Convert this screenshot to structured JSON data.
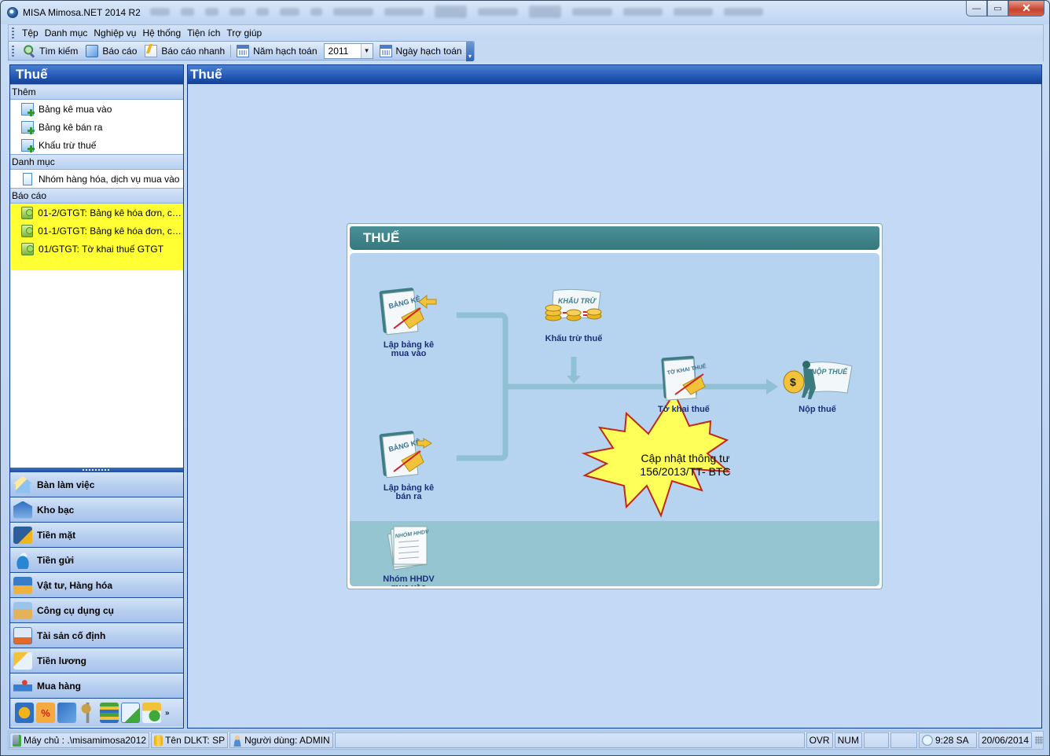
{
  "window": {
    "title": "MISA Mimosa.NET 2014 R2",
    "controls": {
      "minimize": "—",
      "maximize": "▭",
      "close": "✕"
    }
  },
  "menu": [
    "Tệp",
    "Danh mục",
    "Nghiệp vụ",
    "Hệ thống",
    "Tiện ích",
    "Trợ giúp"
  ],
  "toolbar": {
    "search": "Tìm kiếm",
    "report": "Báo cáo",
    "quick_report": "Báo cáo nhanh",
    "fiscal_year_label": "Năm hạch toán",
    "fiscal_year_value": "2011",
    "posting_date": "Ngày hạch toán",
    "overflow": "▾"
  },
  "left_pane": {
    "title": "Thuế",
    "groups": [
      {
        "label": "Thêm",
        "items": [
          "Bảng kê mua vào",
          "Bảng kê bán ra",
          "Khấu trừ thuế"
        ]
      },
      {
        "label": "Danh mục",
        "items": [
          "Nhóm hàng hóa, dịch vụ mua vào"
        ]
      },
      {
        "label": "Báo cáo",
        "items": [
          "01-2/GTGT: Bảng kê hóa đơn, chứ...",
          "01-1/GTGT: Bảng kê hóa đơn, chứ...",
          "01/GTGT: Tờ khai thuế GTGT"
        ]
      }
    ],
    "nav": [
      "Bàn làm việc",
      "Kho bạc",
      "Tiền mặt",
      "Tiền gửi",
      "Vật tư, Hàng hóa",
      "Công cụ dụng cụ",
      "Tài sản cố định",
      "Tiền lương",
      "Mua hàng"
    ],
    "more": "»"
  },
  "main": {
    "title": "Thuế",
    "diagram": {
      "title": "THUẾ",
      "nodes": {
        "purchase_list": {
          "line1": "Lập bảng kê",
          "line2": "mua vào",
          "badge": "BẢNG KÊ"
        },
        "sales_list": {
          "line1": "Lập bảng kê",
          "line2": "bán ra",
          "badge": "BẢNG KÊ"
        },
        "deduction": {
          "line1": "Khấu trừ thuế",
          "badge": "KHẤU TRỪ"
        },
        "declaration": {
          "line1": "Tờ khai thuế",
          "badge": "TỜ KHAI THUẾ"
        },
        "payment": {
          "line1": "Nộp thuế",
          "badge": "NỘP THUẾ"
        },
        "goods_group": {
          "line1": "Nhóm HHDV",
          "line2": "mua vào",
          "badge": "NHÓM HHDV"
        }
      },
      "callout": {
        "line1": "Cập nhật thông tư",
        "line2": "156/2013/TT- BTC"
      }
    }
  },
  "statusbar": {
    "server": "Máy chủ : .\\misamimosa2012",
    "database": "Tên DLKT: SP",
    "user": "Người dùng: ADMIN",
    "ovr": "OVR",
    "num": "NUM",
    "time": "9:28 SA",
    "date": "20/06/2014"
  }
}
